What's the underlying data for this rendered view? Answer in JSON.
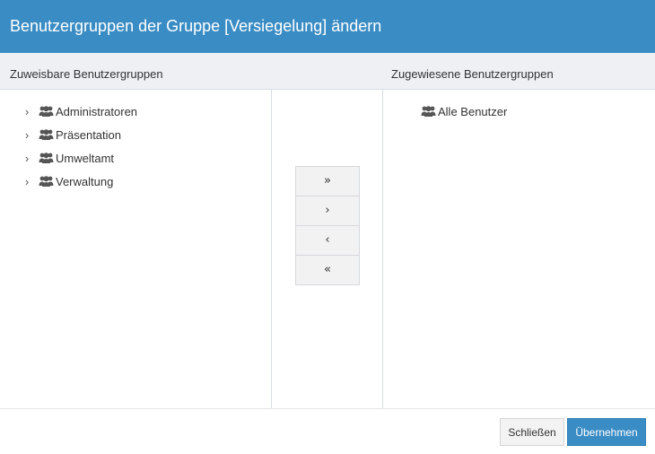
{
  "dialog": {
    "title": "Benutzergruppen der Gruppe [Versiegelung] ändern"
  },
  "columns": {
    "available_label": "Zuweisbare Benutzergruppen",
    "assigned_label": "Zugewiesene Benutzergruppen"
  },
  "available_groups": [
    {
      "label": "Administratoren",
      "icon": "users-icon",
      "expandable": true
    },
    {
      "label": "Präsentation",
      "icon": "users-icon",
      "expandable": true
    },
    {
      "label": "Umweltamt",
      "icon": "users-icon",
      "expandable": true
    },
    {
      "label": "Verwaltung",
      "icon": "users-icon",
      "expandable": true
    }
  ],
  "assigned_groups": [
    {
      "label": "Alle Benutzer",
      "icon": "users-icon",
      "expandable": false
    }
  ],
  "move_buttons": {
    "add_all": "»",
    "add": "›",
    "remove": "‹",
    "remove_all": "«"
  },
  "footer": {
    "close_label": "Schließen",
    "apply_label": "Übernehmen"
  },
  "colors": {
    "accent": "#3a8cc4",
    "header_bg": "#eef0f4"
  }
}
